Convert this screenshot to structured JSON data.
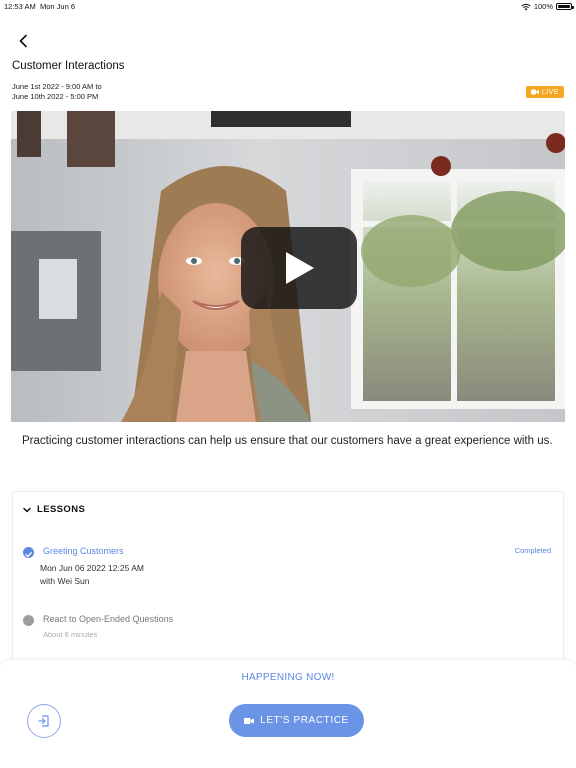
{
  "status_bar": {
    "time": "12:53 AM",
    "date": "Mon Jun 6",
    "battery": "100%"
  },
  "header": {
    "title": "Customer Interactions",
    "date_range_line1": "June 1st 2022 - 9:00 AM to",
    "date_range_line2": "June 10th 2022 - 5:00 PM",
    "live_badge": "LIVE"
  },
  "description": "Practicing customer interactions can help us ensure that our customers have a great experience with us.",
  "lessons": {
    "title": "LESSONS",
    "items": [
      {
        "title": "Greeting Customers",
        "status": "Completed",
        "datetime": "Mon Jun 06 2022 12:25 AM",
        "with": "with Wei Sun"
      },
      {
        "title": "React to Open-Ended Questions",
        "duration": "About 6 minutes"
      }
    ]
  },
  "bottom": {
    "happening_now": "HAPPENING NOW!",
    "practice_label": "LET'S PRACTICE"
  },
  "colors": {
    "accent": "#6b93e6",
    "live": "#f5a623",
    "link": "#5b86e5",
    "pending": "#9e9e9e"
  }
}
